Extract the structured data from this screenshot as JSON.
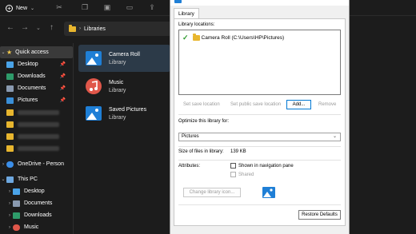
{
  "toolbar": {
    "new_label": "New"
  },
  "address": {
    "path": "Libraries"
  },
  "sidebar": {
    "quick_access": "Quick access",
    "items": [
      {
        "label": "Desktop"
      },
      {
        "label": "Downloads"
      },
      {
        "label": "Documents"
      },
      {
        "label": "Pictures"
      }
    ],
    "onedrive": "OneDrive - Person",
    "this_pc": "This PC",
    "pc_items": [
      {
        "label": "Desktop"
      },
      {
        "label": "Documents"
      },
      {
        "label": "Downloads"
      },
      {
        "label": "Music"
      }
    ]
  },
  "libraries": [
    {
      "name": "Camera Roll",
      "type": "Library"
    },
    {
      "name": "Music",
      "type": "Library"
    },
    {
      "name": "Saved Pictures",
      "type": "Library"
    }
  ],
  "dialog": {
    "tab": "Library",
    "library_locations_label": "Library locations:",
    "location": "Camera Roll (C:\\Users\\HP\\Pictures)",
    "set_save_location": "Set save location",
    "set_public_save_location": "Set public save location",
    "add": "Add...",
    "remove": "Remove",
    "optimize_label": "Optimize this library for:",
    "optimize_value": "Pictures",
    "size_label": "Size of files in library:",
    "size_value": "139 KB",
    "attributes_label": "Attributes:",
    "shown_in_nav": "Shown in navigation pane",
    "shared": "Shared",
    "change_icon": "Change library icon...",
    "restore_defaults": "Restore Defaults"
  },
  "colors": {
    "folder": "#e8b62e",
    "accent": "#0078d4",
    "check": "#2e9a2e"
  }
}
